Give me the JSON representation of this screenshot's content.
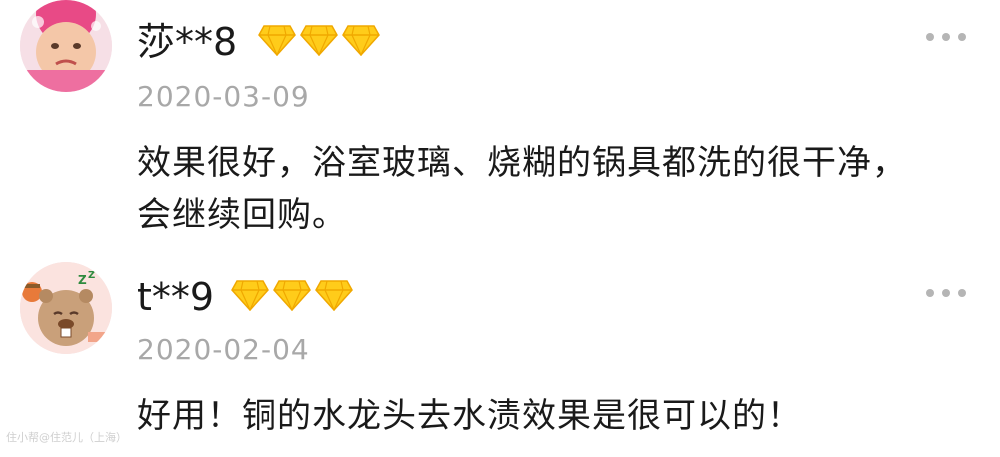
{
  "reviews": [
    {
      "username": "莎**8",
      "date": "2020-03-09",
      "content": "效果很好，浴室玻璃、烧糊的锅具都洗的很干净，会继续回购。",
      "rating_diamonds": 3
    },
    {
      "username": "t**9",
      "date": "2020-02-04",
      "content": "好用！铜的水龙头去水渍效果是很可以的！",
      "rating_diamonds": 3
    }
  ],
  "watermark": "住小帮@住范儿（上海）",
  "colors": {
    "diamond": "#ffcc1a",
    "date_text": "#a8a8a8",
    "more_dots": "#b5b5b5"
  }
}
